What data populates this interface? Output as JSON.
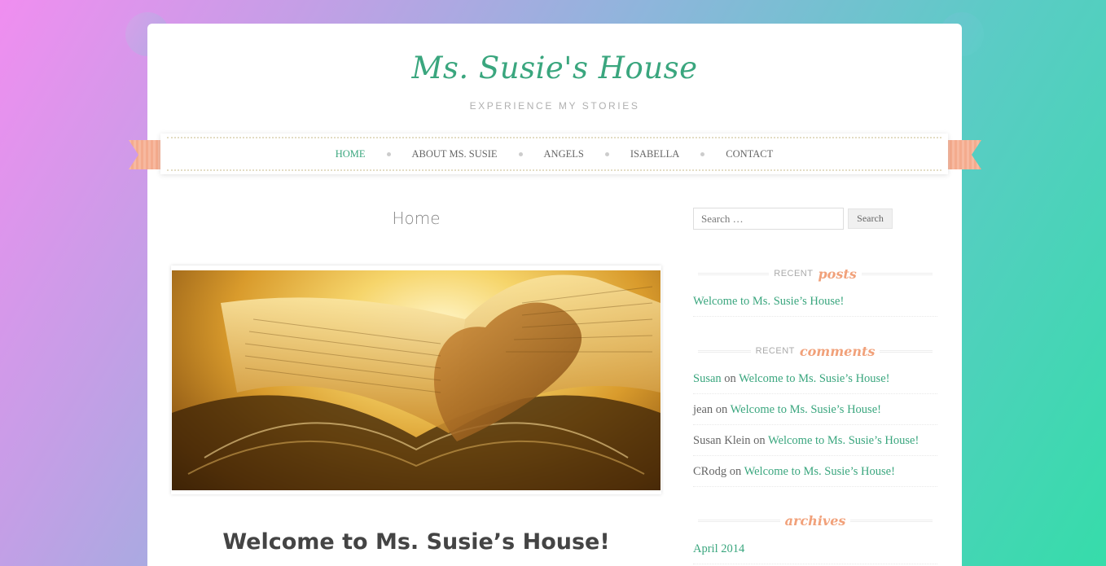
{
  "site": {
    "title": "Ms. Susie's House",
    "tagline": "EXPERIENCE MY STORIES"
  },
  "nav": {
    "items": [
      {
        "label": "HOME",
        "active": true
      },
      {
        "label": "ABOUT MS. SUSIE",
        "active": false
      },
      {
        "label": "ANGELS",
        "active": false
      },
      {
        "label": "ISABELLA",
        "active": false
      },
      {
        "label": "CONTACT",
        "active": false
      }
    ]
  },
  "main": {
    "page_heading": "Home",
    "featured_image": "book-heart-pages",
    "post_title": "Welcome to Ms. Susie’s House!"
  },
  "sidebar": {
    "search": {
      "placeholder": "Search …",
      "button": "Search"
    },
    "recent_posts": {
      "title_small": "RECENT",
      "title_script": "posts",
      "items": [
        "Welcome to Ms. Susie’s House!"
      ]
    },
    "recent_comments": {
      "title_small": "RECENT",
      "title_script": "comments",
      "items": [
        {
          "author": "Susan",
          "on": "on",
          "post": "Welcome to Ms. Susie’s House!"
        },
        {
          "author": "jean",
          "on": "on",
          "post": "Welcome to Ms. Susie’s House!"
        },
        {
          "author": "Susan Klein",
          "on": "on",
          "post": "Welcome to Ms. Susie’s House!"
        },
        {
          "author": "CRodg",
          "on": "on",
          "post": "Welcome to Ms. Susie’s House!"
        }
      ]
    },
    "archives": {
      "title_script": "archives",
      "items": [
        "April 2014"
      ]
    }
  },
  "colors": {
    "accent": "#3aa67e",
    "peach": "#f1a17a",
    "text": "#666666"
  }
}
